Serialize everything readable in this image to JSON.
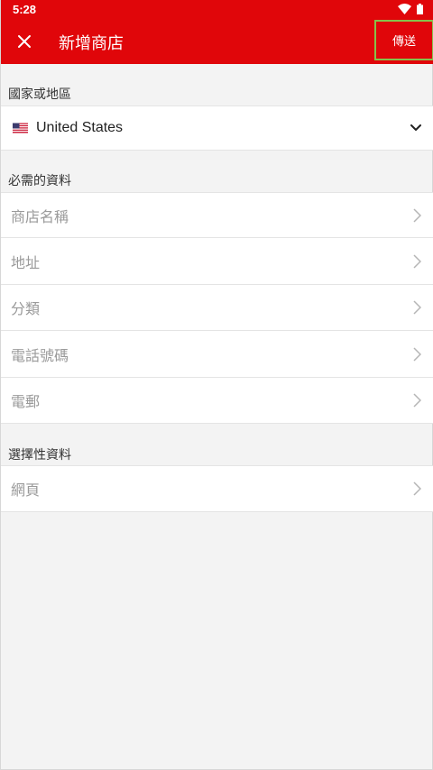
{
  "status_bar": {
    "time": "5:28",
    "icons": [
      "wifi-icon",
      "battery-icon"
    ]
  },
  "app_bar": {
    "title": "新增商店",
    "close_icon": "close-icon",
    "send_label": "傳送",
    "background": "#e0060a"
  },
  "country_section": {
    "header": "國家或地區",
    "selected_country": "United States",
    "flag_icon": "us-flag-icon",
    "dropdown_icon": "chevron-down-icon"
  },
  "required_section": {
    "header": "必需的資料",
    "fields": [
      {
        "label": "商店名稱"
      },
      {
        "label": "地址"
      },
      {
        "label": "分類"
      },
      {
        "label": "電話號碼"
      },
      {
        "label": "電郵"
      }
    ]
  },
  "optional_section": {
    "header": "選擇性資料",
    "fields": [
      {
        "label": "網頁"
      }
    ]
  }
}
